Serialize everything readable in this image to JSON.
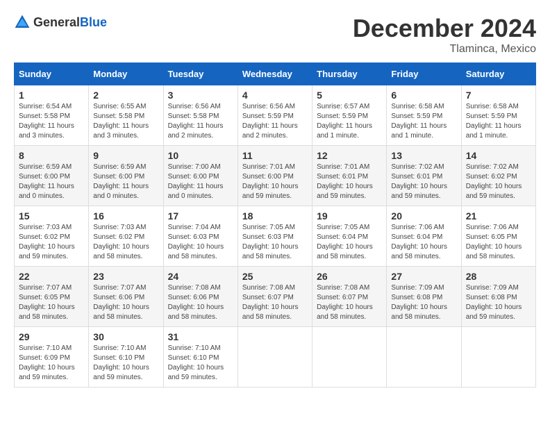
{
  "header": {
    "logo_general": "General",
    "logo_blue": "Blue",
    "month_title": "December 2024",
    "location": "Tlaminca, Mexico"
  },
  "days_of_week": [
    "Sunday",
    "Monday",
    "Tuesday",
    "Wednesday",
    "Thursday",
    "Friday",
    "Saturday"
  ],
  "weeks": [
    [
      {
        "day": "1",
        "sunrise": "6:54 AM",
        "sunset": "5:58 PM",
        "daylight": "11 hours and 3 minutes."
      },
      {
        "day": "2",
        "sunrise": "6:55 AM",
        "sunset": "5:58 PM",
        "daylight": "11 hours and 3 minutes."
      },
      {
        "day": "3",
        "sunrise": "6:56 AM",
        "sunset": "5:58 PM",
        "daylight": "11 hours and 2 minutes."
      },
      {
        "day": "4",
        "sunrise": "6:56 AM",
        "sunset": "5:59 PM",
        "daylight": "11 hours and 2 minutes."
      },
      {
        "day": "5",
        "sunrise": "6:57 AM",
        "sunset": "5:59 PM",
        "daylight": "11 hours and 1 minute."
      },
      {
        "day": "6",
        "sunrise": "6:58 AM",
        "sunset": "5:59 PM",
        "daylight": "11 hours and 1 minute."
      },
      {
        "day": "7",
        "sunrise": "6:58 AM",
        "sunset": "5:59 PM",
        "daylight": "11 hours and 1 minute."
      }
    ],
    [
      {
        "day": "8",
        "sunrise": "6:59 AM",
        "sunset": "6:00 PM",
        "daylight": "11 hours and 0 minutes."
      },
      {
        "day": "9",
        "sunrise": "6:59 AM",
        "sunset": "6:00 PM",
        "daylight": "11 hours and 0 minutes."
      },
      {
        "day": "10",
        "sunrise": "7:00 AM",
        "sunset": "6:00 PM",
        "daylight": "11 hours and 0 minutes."
      },
      {
        "day": "11",
        "sunrise": "7:01 AM",
        "sunset": "6:00 PM",
        "daylight": "10 hours and 59 minutes."
      },
      {
        "day": "12",
        "sunrise": "7:01 AM",
        "sunset": "6:01 PM",
        "daylight": "10 hours and 59 minutes."
      },
      {
        "day": "13",
        "sunrise": "7:02 AM",
        "sunset": "6:01 PM",
        "daylight": "10 hours and 59 minutes."
      },
      {
        "day": "14",
        "sunrise": "7:02 AM",
        "sunset": "6:02 PM",
        "daylight": "10 hours and 59 minutes."
      }
    ],
    [
      {
        "day": "15",
        "sunrise": "7:03 AM",
        "sunset": "6:02 PM",
        "daylight": "10 hours and 59 minutes."
      },
      {
        "day": "16",
        "sunrise": "7:03 AM",
        "sunset": "6:02 PM",
        "daylight": "10 hours and 58 minutes."
      },
      {
        "day": "17",
        "sunrise": "7:04 AM",
        "sunset": "6:03 PM",
        "daylight": "10 hours and 58 minutes."
      },
      {
        "day": "18",
        "sunrise": "7:05 AM",
        "sunset": "6:03 PM",
        "daylight": "10 hours and 58 minutes."
      },
      {
        "day": "19",
        "sunrise": "7:05 AM",
        "sunset": "6:04 PM",
        "daylight": "10 hours and 58 minutes."
      },
      {
        "day": "20",
        "sunrise": "7:06 AM",
        "sunset": "6:04 PM",
        "daylight": "10 hours and 58 minutes."
      },
      {
        "day": "21",
        "sunrise": "7:06 AM",
        "sunset": "6:05 PM",
        "daylight": "10 hours and 58 minutes."
      }
    ],
    [
      {
        "day": "22",
        "sunrise": "7:07 AM",
        "sunset": "6:05 PM",
        "daylight": "10 hours and 58 minutes."
      },
      {
        "day": "23",
        "sunrise": "7:07 AM",
        "sunset": "6:06 PM",
        "daylight": "10 hours and 58 minutes."
      },
      {
        "day": "24",
        "sunrise": "7:08 AM",
        "sunset": "6:06 PM",
        "daylight": "10 hours and 58 minutes."
      },
      {
        "day": "25",
        "sunrise": "7:08 AM",
        "sunset": "6:07 PM",
        "daylight": "10 hours and 58 minutes."
      },
      {
        "day": "26",
        "sunrise": "7:08 AM",
        "sunset": "6:07 PM",
        "daylight": "10 hours and 58 minutes."
      },
      {
        "day": "27",
        "sunrise": "7:09 AM",
        "sunset": "6:08 PM",
        "daylight": "10 hours and 58 minutes."
      },
      {
        "day": "28",
        "sunrise": "7:09 AM",
        "sunset": "6:08 PM",
        "daylight": "10 hours and 59 minutes."
      }
    ],
    [
      {
        "day": "29",
        "sunrise": "7:10 AM",
        "sunset": "6:09 PM",
        "daylight": "10 hours and 59 minutes."
      },
      {
        "day": "30",
        "sunrise": "7:10 AM",
        "sunset": "6:10 PM",
        "daylight": "10 hours and 59 minutes."
      },
      {
        "day": "31",
        "sunrise": "7:10 AM",
        "sunset": "6:10 PM",
        "daylight": "10 hours and 59 minutes."
      },
      null,
      null,
      null,
      null
    ]
  ],
  "labels": {
    "sunrise": "Sunrise:",
    "sunset": "Sunset:",
    "daylight": "Daylight:"
  }
}
